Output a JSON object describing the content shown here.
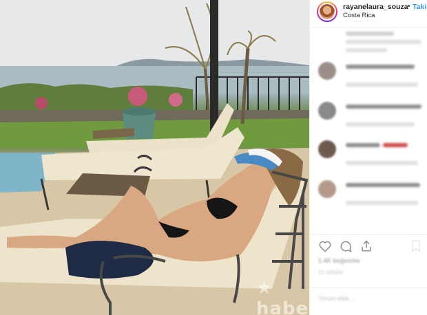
{
  "post": {
    "username": "rayanelaura_souza",
    "separator": "•",
    "follow_label": "Takip",
    "location": "Costa Rica"
  },
  "comments": [
    {
      "avatar_color": "#c9c9c9"
    },
    {
      "avatar_color": "#9a8f8a"
    },
    {
      "avatar_color": "#8a8a8a"
    },
    {
      "avatar_color": "#6e5a4e"
    },
    {
      "avatar_color": "#b59a8a"
    }
  ],
  "actions": {
    "icons": [
      "heart-icon",
      "comment-icon",
      "share-icon",
      "bookmark-icon"
    ]
  },
  "footer": {
    "likes_text": "1.4K beğenme",
    "date_text": "21 NİSAN",
    "add_comment_placeholder": "Yorum ekle..."
  },
  "colors": {
    "accent": "#3897f0",
    "text": "#262626"
  }
}
